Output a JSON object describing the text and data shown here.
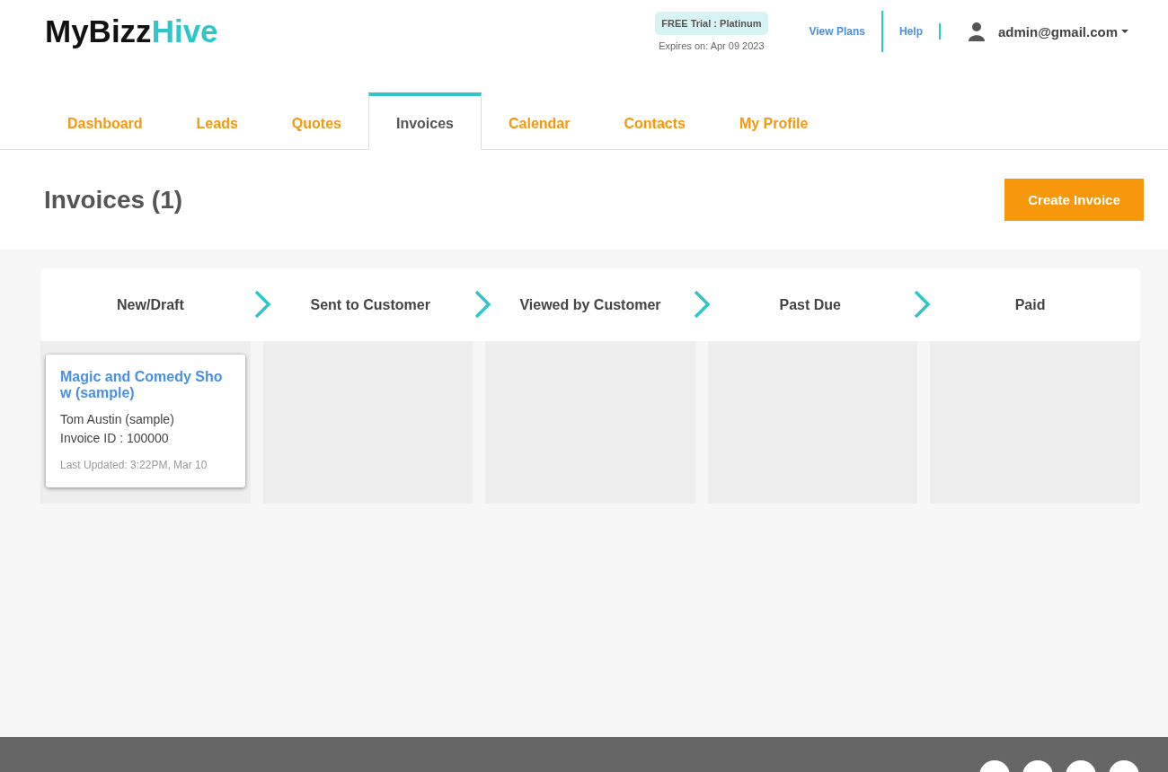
{
  "header": {
    "logo": {
      "part_1": "MyBizz",
      "part_2": "Hive"
    },
    "plan_badge": "FREE Trial : Platinum",
    "expires": "Expires on: Apr 09 2023",
    "links": [
      "View Plans",
      "Help"
    ],
    "user": "admin@gmail.com"
  },
  "tabs": [
    {
      "label": "Dashboard",
      "selected": false
    },
    {
      "label": "Leads",
      "selected": false
    },
    {
      "label": "Quotes",
      "selected": false
    },
    {
      "label": "Invoices",
      "selected": true
    },
    {
      "label": "Calendar",
      "selected": false
    },
    {
      "label": "Contacts",
      "selected": false
    },
    {
      "label": "My Profile",
      "selected": false
    }
  ],
  "page_title": "Invoices (1)",
  "create_button": "Create Invoice",
  "stages": [
    {
      "label": "New/Draft",
      "cards": [
        {
          "title": "Magic and Comedy Show (sample)",
          "customer": "Tom Austin (sample)",
          "invoice_id": "Invoice ID : 100000",
          "updated": "Last Updated: 3:22PM, Mar 10"
        }
      ]
    },
    {
      "label": "Sent to Customer"
    },
    {
      "label": "Viewed by Customer"
    },
    {
      "label": "Past Due"
    },
    {
      "label": "Paid"
    }
  ]
}
